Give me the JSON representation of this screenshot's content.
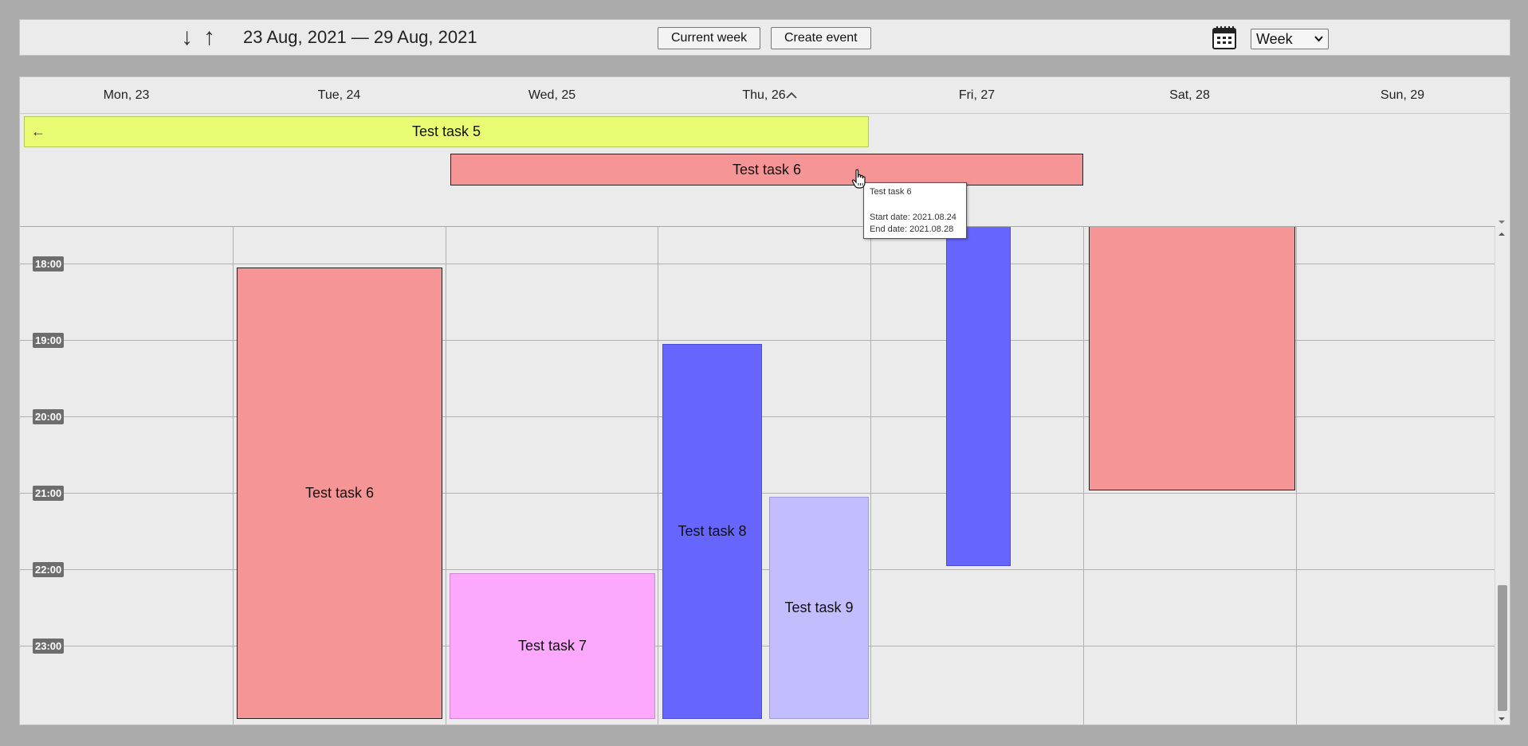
{
  "toolbar": {
    "prev_icon": "arrow-down-icon",
    "next_icon": "arrow-up-icon",
    "prev_glyph": "↓",
    "next_glyph": "↑",
    "range_label": "23 Aug, 2021 — 29 Aug, 2021",
    "current_week_label": "Current week",
    "create_event_label": "Create event",
    "calendar_icon": "calendar-icon",
    "view_selected": "Week"
  },
  "days": [
    {
      "label": "Mon, 23"
    },
    {
      "label": "Tue, 24"
    },
    {
      "label": "Wed, 25"
    },
    {
      "label": "Thu, 26"
    },
    {
      "label": "Fri, 27"
    },
    {
      "label": "Sat, 28"
    },
    {
      "label": "Sun, 29"
    }
  ],
  "allday_events": [
    {
      "title": "Test task 5",
      "color": "#e8fb72",
      "arrow_glyph": "←"
    },
    {
      "title": "Test task 6",
      "color": "#f59595"
    }
  ],
  "time_labels": [
    "18:00",
    "19:00",
    "20:00",
    "21:00",
    "22:00",
    "23:00"
  ],
  "events": [
    {
      "title": "Test task 6",
      "color": "#f59595"
    },
    {
      "title": "Test task 7",
      "color": "#fca8fc"
    },
    {
      "title": "Test task 8",
      "color": "#6666ff"
    },
    {
      "title": "Test task 9",
      "color": "#c2bdfd"
    },
    {
      "title": "",
      "color": "#6666ff"
    },
    {
      "title": "",
      "color": "#f59595"
    }
  ],
  "tooltip": {
    "title": "Test task 6",
    "start": "Start date: 2021.08.24",
    "end": "End date: 2021.08.28"
  },
  "colors": {
    "background": "#aaaaaa",
    "panel": "#ebebeb",
    "time_label_bg": "#6d6d6d"
  }
}
